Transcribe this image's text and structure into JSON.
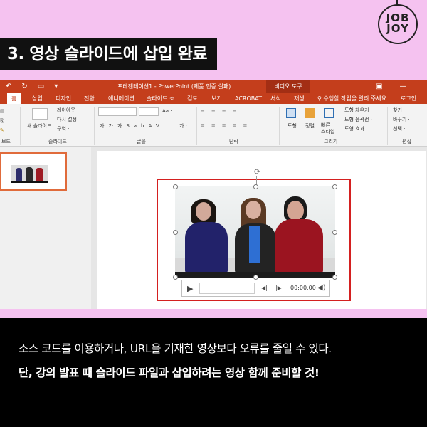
{
  "brand": {
    "logo_line1": "JOB",
    "logo_line2": "JOY"
  },
  "heading": "3. 영상 슬라이드에 삽입 완료",
  "ppt": {
    "title": "프레젠테이션1 - PowerPoint (제품 인증 실패)",
    "video_tools": "비디오 도구",
    "tabs": [
      "홈",
      "삽입",
      "디자인",
      "전환",
      "애니메이션",
      "슬라이드 쇼",
      "검토",
      "보기",
      "ACROBAT",
      "서식",
      "재생"
    ],
    "tell_me": "♀ 수행할 작업을 알려 주세요",
    "login": "로그인",
    "ribbon": {
      "new_slide": "새 슬라이드",
      "layout": "레이아웃 ·",
      "reset": "다시 설정",
      "section": "구역 ·",
      "group_clipboard": "보드",
      "group_slides": "슬라이드",
      "group_font": "글꼴",
      "group_paragraph": "단락",
      "group_drawing": "그리기",
      "group_editing": "편집",
      "shape": "도형",
      "arrange": "정렬",
      "quick_styles": "빠른\n스타일",
      "shape_fill": "도형 채우기 ·",
      "shape_outline": "도형 윤곽선 ·",
      "shape_effects": "도형 효과 ·",
      "find": "찾기",
      "replace": "바꾸기 ·",
      "select": "선택 ·",
      "font_aa": "Aa ·",
      "font_ga": "가 ·"
    },
    "player": {
      "time": "00:00.00"
    }
  },
  "caption": {
    "line1": "소스 코드를 이용하거나, URL을 기재한 영상보다 오류를 줄일 수 있다.",
    "line2": "단, 강의 발표 때 슬라이드 파일과 삽입하려는 영상 함께 준비할 것!"
  },
  "colors": {
    "accent": "#c43e1c",
    "background": "#f5c2f0",
    "selection": "#d42020"
  }
}
